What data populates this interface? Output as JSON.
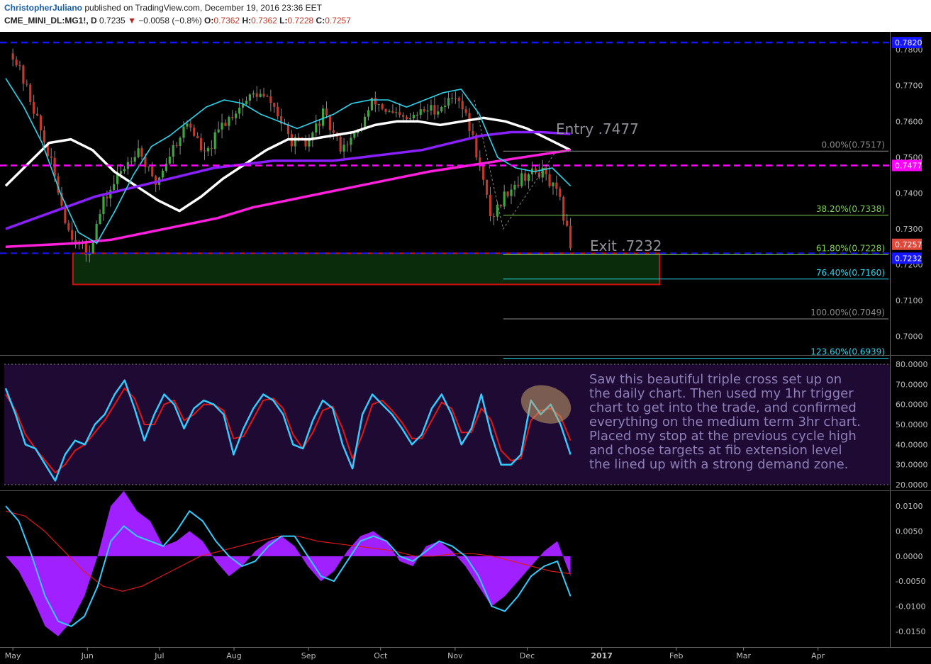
{
  "header": {
    "author": "ChristopherJuliano",
    "published": "published on TradingView.com, December 19, 2016 23:36 EET",
    "symbol": "CME_MINI_DL:MG1!, D",
    "last": "0.7235",
    "change_arrow": "▼",
    "change": "−0.0058 (−0.8%)",
    "o_label": "O:",
    "o": "0.7362",
    "h_label": "H:",
    "h": "0.7362",
    "l_label": "L:",
    "l": "0.7228",
    "c_label": "C:",
    "c": "0.7257"
  },
  "colors": {
    "background": "#000000",
    "stoch_bg": "#1e0a33",
    "entry_line": "#ff00ff",
    "blue_levels": "#1515ff",
    "ma_white": "#ffffff",
    "ma_purple": "#8a20ff",
    "ma_magenta": "#ff1fdc",
    "ma_cyan": "#2ad6ee",
    "demand_zone_fill": "#0a2c0a",
    "demand_zone_border": "#d01010",
    "annotation_text": "#8e7fb9",
    "osc_fill": "#a020ff"
  },
  "price_axis": {
    "ticks": [
      "0.7800",
      "0.7700",
      "0.7600",
      "0.7500",
      "0.7400",
      "0.7300",
      "0.7200",
      "0.7100",
      "0.7000"
    ],
    "labels": {
      "top_level": "0.7820",
      "entry_level": "0.7477",
      "last_price": "0.7257",
      "exit_level": "0.7232"
    }
  },
  "x_axis": [
    "May",
    "Jun",
    "Jul",
    "Aug",
    "Sep",
    "Oct",
    "Nov",
    "Dec",
    "2017",
    "Feb",
    "Mar",
    "Apr"
  ],
  "annotations": {
    "entry": "Entry .7477",
    "exit": "Exit .7232",
    "note": "Saw this beautiful triple cross set up on the daily chart. Then used my 1hr trigger chart to get into the trade, and confirmed everything on the medium term 3hr chart.  Placed my stop at the previous cycle high and chose targets at fib extension level the lined up with a strong demand zone."
  },
  "fib_levels": [
    {
      "label": "0.00%(0.7517)",
      "price": 0.7517,
      "color": "#8a8a8a"
    },
    {
      "label": "38.20%(0.7338)",
      "price": 0.7338,
      "color": "#7cd14a"
    },
    {
      "label": "61.80%(0.7228)",
      "price": 0.7228,
      "color": "#7cd14a"
    },
    {
      "label": "76.40%(0.7160)",
      "price": 0.716,
      "color": "#2ad6ee"
    },
    {
      "label": "100.00%(0.7049)",
      "price": 0.7049,
      "color": "#8a8a8a"
    },
    {
      "label": "123.60%(0.6939)",
      "price": 0.6939,
      "color": "#2ad6ee"
    }
  ],
  "stoch_axis": [
    "80.0000",
    "70.0000",
    "60.0000",
    "50.0000",
    "40.0000",
    "30.0000",
    "20.0000"
  ],
  "osc_axis": [
    "0.0100",
    "0.0050",
    "0.0000",
    "-0.0050",
    "-0.0100",
    "-0.0150"
  ],
  "chart_data": [
    {
      "type": "line",
      "panel": "price",
      "title": "CME_MINI_DL:MG1!, D",
      "ylim": [
        0.695,
        0.783
      ],
      "xlim": [
        "2016-04-28",
        "2017-04-30"
      ],
      "x_ticks": [
        "May",
        "Jun",
        "Jul",
        "Aug",
        "Sep",
        "Oct",
        "Nov",
        "Dec",
        "2017",
        "Feb",
        "Mar",
        "Apr"
      ],
      "horizontal_levels": [
        0.782,
        0.7477,
        0.7232
      ],
      "demand_zone": {
        "x": [
          "2016-05-26",
          "2017-01-25"
        ],
        "y": [
          0.7145,
          0.7232
        ]
      },
      "close_series": {
        "x": [
          "2016-05-01",
          "2016-05-09",
          "2016-05-17",
          "2016-05-24",
          "2016-06-01",
          "2016-06-08",
          "2016-06-15",
          "2016-06-22",
          "2016-06-29",
          "2016-07-06",
          "2016-07-13",
          "2016-07-20",
          "2016-07-27",
          "2016-08-03",
          "2016-08-10",
          "2016-08-17",
          "2016-08-24",
          "2016-08-31",
          "2016-09-07",
          "2016-09-14",
          "2016-09-21",
          "2016-09-28",
          "2016-10-05",
          "2016-10-12",
          "2016-10-19",
          "2016-10-26",
          "2016-11-02",
          "2016-11-09",
          "2016-11-16",
          "2016-11-23",
          "2016-11-30",
          "2016-12-07",
          "2016-12-14",
          "2016-12-19"
        ],
        "values": [
          0.779,
          0.765,
          0.748,
          0.73,
          0.7225,
          0.738,
          0.746,
          0.753,
          0.742,
          0.752,
          0.76,
          0.75,
          0.759,
          0.764,
          0.768,
          0.765,
          0.755,
          0.753,
          0.762,
          0.753,
          0.756,
          0.766,
          0.762,
          0.76,
          0.763,
          0.764,
          0.768,
          0.754,
          0.733,
          0.741,
          0.745,
          0.746,
          0.739,
          0.7257
        ]
      },
      "series": [
        {
          "values": [
            0.742,
            0.748,
            0.754,
            0.755,
            0.752,
            0.746,
            0.742,
            0.738,
            0.735,
            0.739,
            0.744,
            0.748,
            0.752,
            0.755,
            0.755,
            0.756,
            0.757,
            0.759,
            0.76,
            0.76,
            0.759,
            0.76,
            0.761,
            0.76,
            0.758,
            0.755,
            0.752
          ]
        },
        {
          "values": [
            0.73,
            0.733,
            0.736,
            0.739,
            0.741,
            0.743,
            0.745,
            0.747,
            0.748,
            0.749,
            0.749,
            0.749,
            0.75,
            0.751,
            0.752,
            0.754,
            0.756,
            0.757,
            0.757,
            0.7565
          ]
        },
        {
          "values": [
            0.725,
            0.7255,
            0.726,
            0.727,
            0.729,
            0.731,
            0.733,
            0.736,
            0.738,
            0.74,
            0.742,
            0.744,
            0.746,
            0.7475,
            0.749,
            0.7505,
            0.752
          ]
        },
        {
          "values": [
            0.772,
            0.764,
            0.754,
            0.74,
            0.729,
            0.726,
            0.735,
            0.745,
            0.753,
            0.756,
            0.76,
            0.764,
            0.766,
            0.765,
            0.762,
            0.76,
            0.758,
            0.76,
            0.762,
            0.765,
            0.766,
            0.766,
            0.764,
            0.766,
            0.768,
            0.769,
            0.762,
            0.75,
            0.747,
            0.746,
            0.747,
            0.742
          ]
        }
      ]
    },
    {
      "type": "line",
      "panel": "stochastic",
      "ylim": [
        20,
        80
      ],
      "series": [
        {
          "values": [
            68,
            55,
            40,
            38,
            30,
            22,
            35,
            42,
            40,
            50,
            55,
            65,
            72,
            58,
            42,
            55,
            65,
            60,
            48,
            58,
            62,
            60,
            55,
            35,
            48,
            58,
            65,
            62,
            55,
            40,
            38,
            52,
            62,
            58,
            40,
            28,
            55,
            65,
            60,
            55,
            48,
            40,
            45,
            58,
            65,
            55,
            40,
            48,
            65,
            45,
            30,
            30,
            35,
            62,
            55,
            60,
            50,
            35
          ]
        },
        {
          "values": [
            65,
            57,
            45,
            38,
            32,
            26,
            30,
            37,
            40,
            46,
            52,
            60,
            68,
            63,
            50,
            50,
            60,
            62,
            52,
            55,
            60,
            60,
            57,
            43,
            44,
            53,
            62,
            63,
            58,
            45,
            38,
            46,
            57,
            59,
            48,
            33,
            45,
            60,
            62,
            57,
            51,
            43,
            43,
            52,
            61,
            58,
            46,
            46,
            58,
            52,
            37,
            32,
            33,
            52,
            57,
            58,
            54,
            42
          ]
        }
      ]
    },
    {
      "type": "area",
      "panel": "oscillator",
      "ylim": [
        -0.017,
        0.012
      ],
      "series": [
        {
          "values": [
            0.0,
            -0.003,
            -0.008,
            -0.014,
            -0.016,
            -0.013,
            -0.008,
            0.0,
            0.01,
            0.013,
            0.009,
            0.007,
            0.002,
            0.003,
            0.005,
            0.003,
            -0.001,
            -0.004,
            -0.002,
            0.001,
            0.003,
            0.004,
            0.002,
            -0.002,
            -0.005,
            -0.003,
            0.001,
            0.004,
            0.005,
            0.003,
            -0.001,
            -0.002,
            0.002,
            0.003,
            0.001,
            -0.002,
            -0.006,
            -0.01,
            -0.008,
            -0.005,
            -0.002,
            0.001,
            0.003,
            -0.004
          ]
        },
        {
          "values": [
            0.01,
            0.007,
            0.0,
            -0.008,
            -0.013,
            -0.014,
            -0.012,
            -0.006,
            0.003,
            0.006,
            0.004,
            0.003,
            0.002,
            0.005,
            0.009,
            0.007,
            0.003,
            0.0,
            -0.002,
            -0.001,
            0.002,
            0.004,
            0.004,
            0.0,
            -0.004,
            -0.005,
            -0.001,
            0.003,
            0.004,
            0.003,
            0.0,
            -0.001,
            0.001,
            0.003,
            0.002,
            0.0,
            -0.004,
            -0.01,
            -0.011,
            -0.008,
            -0.004,
            -0.002,
            -0.001,
            -0.008
          ]
        },
        {
          "values": [
            0.009,
            0.008,
            0.005,
            0.001,
            -0.003,
            -0.006,
            -0.007,
            -0.006,
            -0.004,
            -0.002,
            0.0,
            0.001,
            0.002,
            0.003,
            0.004,
            0.004,
            0.003,
            0.0025,
            0.002,
            0.0015,
            0.001,
            0.0,
            0.0,
            0.0005,
            0.0005,
            0.0,
            -0.001,
            -0.002,
            -0.003,
            -0.0035
          ]
        }
      ]
    }
  ]
}
